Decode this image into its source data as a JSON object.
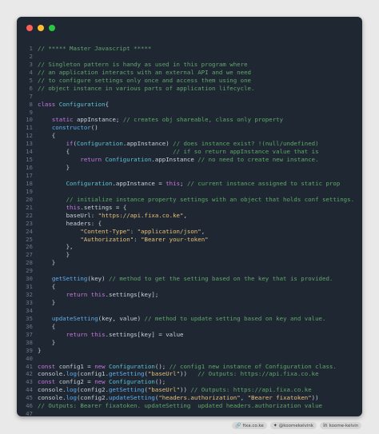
{
  "window": {
    "traffic_lights": [
      {
        "name": "close",
        "color": "#ff5f57"
      },
      {
        "name": "minimize",
        "color": "#febc2e"
      },
      {
        "name": "maximize",
        "color": "#28c840"
      }
    ]
  },
  "colors": {
    "background": "#e9e9e9",
    "editor": "#1f2732",
    "comment": "#5fa86a",
    "keyword": "#c678dd",
    "class": "#5fc4d6",
    "string": "#e6c07b",
    "function": "#61afef",
    "plain": "#c9d1d9",
    "line_number": "#6b7685"
  },
  "code_lines": [
    [
      [
        "c",
        "// ***** Master Javascript *****"
      ]
    ],
    [],
    [
      [
        "c",
        "// Singleton pattern is handy as used in this program where"
      ]
    ],
    [
      [
        "c",
        "// an application interacts with an external API and we need"
      ]
    ],
    [
      [
        "c",
        "// to configure settings only once and access them using one"
      ]
    ],
    [
      [
        "c",
        "// object instance in various parts of application lifecycle."
      ]
    ],
    [],
    [
      [
        "k",
        "class "
      ],
      [
        "t",
        "Configuration"
      ],
      [
        "p",
        "{"
      ]
    ],
    [],
    [
      [
        "p",
        "    "
      ],
      [
        "k",
        "static "
      ],
      [
        "p",
        "appInstance; "
      ],
      [
        "c",
        "// creates obj shareable, class only property"
      ]
    ],
    [
      [
        "p",
        "    "
      ],
      [
        "f",
        "constructor"
      ],
      [
        "p",
        "()"
      ]
    ],
    [
      [
        "p",
        "    {"
      ]
    ],
    [
      [
        "p",
        "        "
      ],
      [
        "k",
        "if"
      ],
      [
        "p",
        "("
      ],
      [
        "t",
        "Configuration"
      ],
      [
        "p",
        ".appInstance) "
      ],
      [
        "c",
        "// does instance exist? !(null/undefined)"
      ]
    ],
    [
      [
        "p",
        "        {                             "
      ],
      [
        "c",
        "// if so return appInstance value that is"
      ]
    ],
    [
      [
        "p",
        "            "
      ],
      [
        "k",
        "return "
      ],
      [
        "t",
        "Configuration"
      ],
      [
        "p",
        ".appInstance "
      ],
      [
        "c",
        "// no need to create new instance."
      ]
    ],
    [
      [
        "p",
        "        }"
      ]
    ],
    [],
    [
      [
        "p",
        "        "
      ],
      [
        "t",
        "Configuration"
      ],
      [
        "p",
        ".appInstance = "
      ],
      [
        "k",
        "this"
      ],
      [
        "p",
        "; "
      ],
      [
        "c",
        "// current instance assigned to static prop"
      ]
    ],
    [],
    [
      [
        "p",
        "        "
      ],
      [
        "c",
        "// initialize instance property settings with an object that holds conf settings."
      ]
    ],
    [
      [
        "p",
        "        "
      ],
      [
        "k",
        "this"
      ],
      [
        "p",
        ".settings = {"
      ]
    ],
    [
      [
        "p",
        "        baseUrl: "
      ],
      [
        "s",
        "\"https://api.fixa.co.ke\""
      ],
      [
        "p",
        ","
      ]
    ],
    [
      [
        "p",
        "        headers: {"
      ]
    ],
    [
      [
        "p",
        "            "
      ],
      [
        "s",
        "\"Content-Type\""
      ],
      [
        "p",
        ": "
      ],
      [
        "s",
        "\"application/json\""
      ],
      [
        "p",
        ","
      ]
    ],
    [
      [
        "p",
        "            "
      ],
      [
        "s",
        "\"Authorization\""
      ],
      [
        "p",
        ": "
      ],
      [
        "s",
        "\"Bearer your-token\""
      ]
    ],
    [
      [
        "p",
        "        },"
      ]
    ],
    [
      [
        "p",
        "        }"
      ]
    ],
    [
      [
        "p",
        "    }"
      ]
    ],
    [],
    [
      [
        "p",
        "    "
      ],
      [
        "f",
        "getSetting"
      ],
      [
        "p",
        "(key) "
      ],
      [
        "c",
        "// method to get the setting based on the key that is provided."
      ]
    ],
    [
      [
        "p",
        "    {"
      ]
    ],
    [
      [
        "p",
        "        "
      ],
      [
        "k",
        "return "
      ],
      [
        "k",
        "this"
      ],
      [
        "p",
        ".settings[key];"
      ]
    ],
    [
      [
        "p",
        "    }"
      ]
    ],
    [],
    [
      [
        "p",
        "    "
      ],
      [
        "f",
        "updateSetting"
      ],
      [
        "p",
        "(key, value) "
      ],
      [
        "c",
        "// method to update setting based on key and value."
      ]
    ],
    [
      [
        "p",
        "    {"
      ]
    ],
    [
      [
        "p",
        "        "
      ],
      [
        "k",
        "return "
      ],
      [
        "k",
        "this"
      ],
      [
        "p",
        ".settings[key] = value"
      ]
    ],
    [
      [
        "p",
        "    }"
      ]
    ],
    [
      [
        "p",
        "}"
      ]
    ],
    [],
    [
      [
        "k",
        "const "
      ],
      [
        "p",
        "config1 = "
      ],
      [
        "k",
        "new "
      ],
      [
        "t",
        "Configuration"
      ],
      [
        "p",
        "(); "
      ],
      [
        "c",
        "// config1 new instance of Configuration class."
      ]
    ],
    [
      [
        "p",
        "console."
      ],
      [
        "f",
        "log"
      ],
      [
        "p",
        "(config1."
      ],
      [
        "f",
        "getSetting"
      ],
      [
        "p",
        "("
      ],
      [
        "s",
        "\"baseUrl\""
      ],
      [
        "p",
        "))   "
      ],
      [
        "c",
        "// Outputs: https://api.fixa.co.ke"
      ]
    ],
    [
      [
        "k",
        "const "
      ],
      [
        "p",
        "config2 = "
      ],
      [
        "k",
        "new "
      ],
      [
        "t",
        "Configuration"
      ],
      [
        "p",
        "();"
      ]
    ],
    [
      [
        "p",
        "console."
      ],
      [
        "f",
        "log"
      ],
      [
        "p",
        "(config2."
      ],
      [
        "f",
        "getSetting"
      ],
      [
        "p",
        "("
      ],
      [
        "s",
        "\"baseUrl\""
      ],
      [
        "p",
        ")) "
      ],
      [
        "c",
        "// Outputs: https://api.fixa.co.ke"
      ]
    ],
    [
      [
        "p",
        "console."
      ],
      [
        "f",
        "log"
      ],
      [
        "p",
        "(config2."
      ],
      [
        "f",
        "updateSetting"
      ],
      [
        "p",
        "("
      ],
      [
        "s",
        "\"headers.authorization\""
      ],
      [
        "p",
        ", "
      ],
      [
        "s",
        "\"Bearer fixatoken\""
      ],
      [
        "p",
        "))"
      ]
    ],
    [
      [
        "c",
        "// Outputs: Bearer fixatoken. updateSetting  updated headers.authorization value"
      ]
    ],
    []
  ],
  "footer": {
    "site": "fixa.co.ke",
    "handle": "@koomekelvink",
    "name": "koome-kelvin"
  }
}
